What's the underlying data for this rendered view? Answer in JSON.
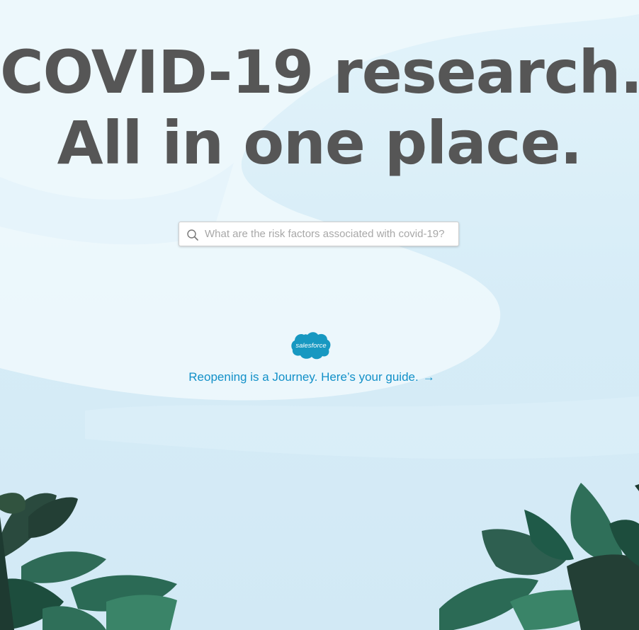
{
  "hero": {
    "line1": "COVID-19 research.",
    "line2": "All in one place."
  },
  "search": {
    "placeholder": "What are the risk factors associated with covid-19?",
    "value": "",
    "icon": "search-icon"
  },
  "logo": {
    "text": "salesforce",
    "color": "#1798c1"
  },
  "guide_link": {
    "text": "Reopening is a Journey. Here’s your guide.",
    "arrow": "→"
  },
  "colors": {
    "background": "#d7ecf7",
    "heading": "#565656",
    "link": "#1290c8",
    "leaf_dark": "#1f5a48",
    "leaf_mid": "#2f7a60"
  }
}
